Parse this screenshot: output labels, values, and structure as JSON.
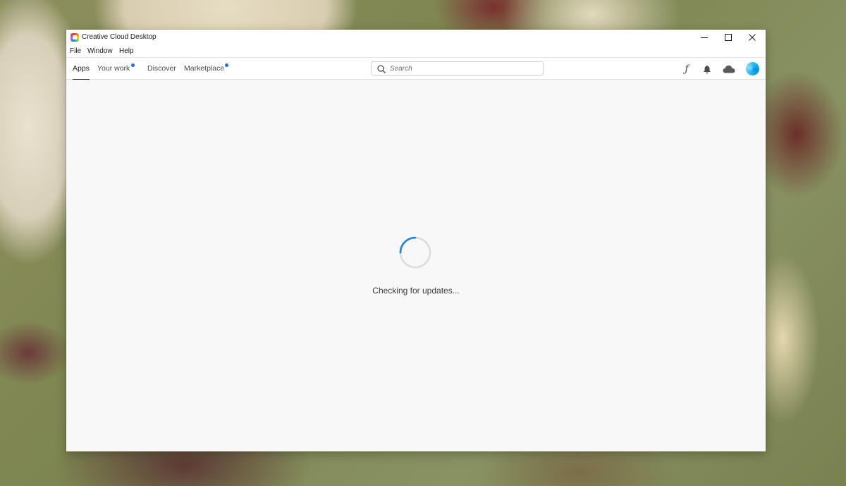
{
  "window": {
    "title": "Creative Cloud Desktop"
  },
  "menubar": {
    "items": [
      {
        "label": "File"
      },
      {
        "label": "Window"
      },
      {
        "label": "Help"
      }
    ]
  },
  "nav": {
    "tabs": [
      {
        "label": "Apps",
        "active": true,
        "has_notification": false
      },
      {
        "label": "Your work",
        "active": false,
        "has_notification": true
      },
      {
        "label": "Discover",
        "active": false,
        "has_notification": false
      },
      {
        "label": "Marketplace",
        "active": false,
        "has_notification": true
      }
    ],
    "search": {
      "placeholder": "Search",
      "value": ""
    },
    "icons": [
      {
        "name": "fonts-icon"
      },
      {
        "name": "bell-icon"
      },
      {
        "name": "cloud-icon"
      },
      {
        "name": "avatar"
      }
    ]
  },
  "content": {
    "status": "Checking for updates..."
  },
  "colors": {
    "accent": "#1473e6",
    "spinner_active": "#2680eb",
    "spinner_track": "#dcdcdc",
    "background": "#f8f8f8"
  }
}
